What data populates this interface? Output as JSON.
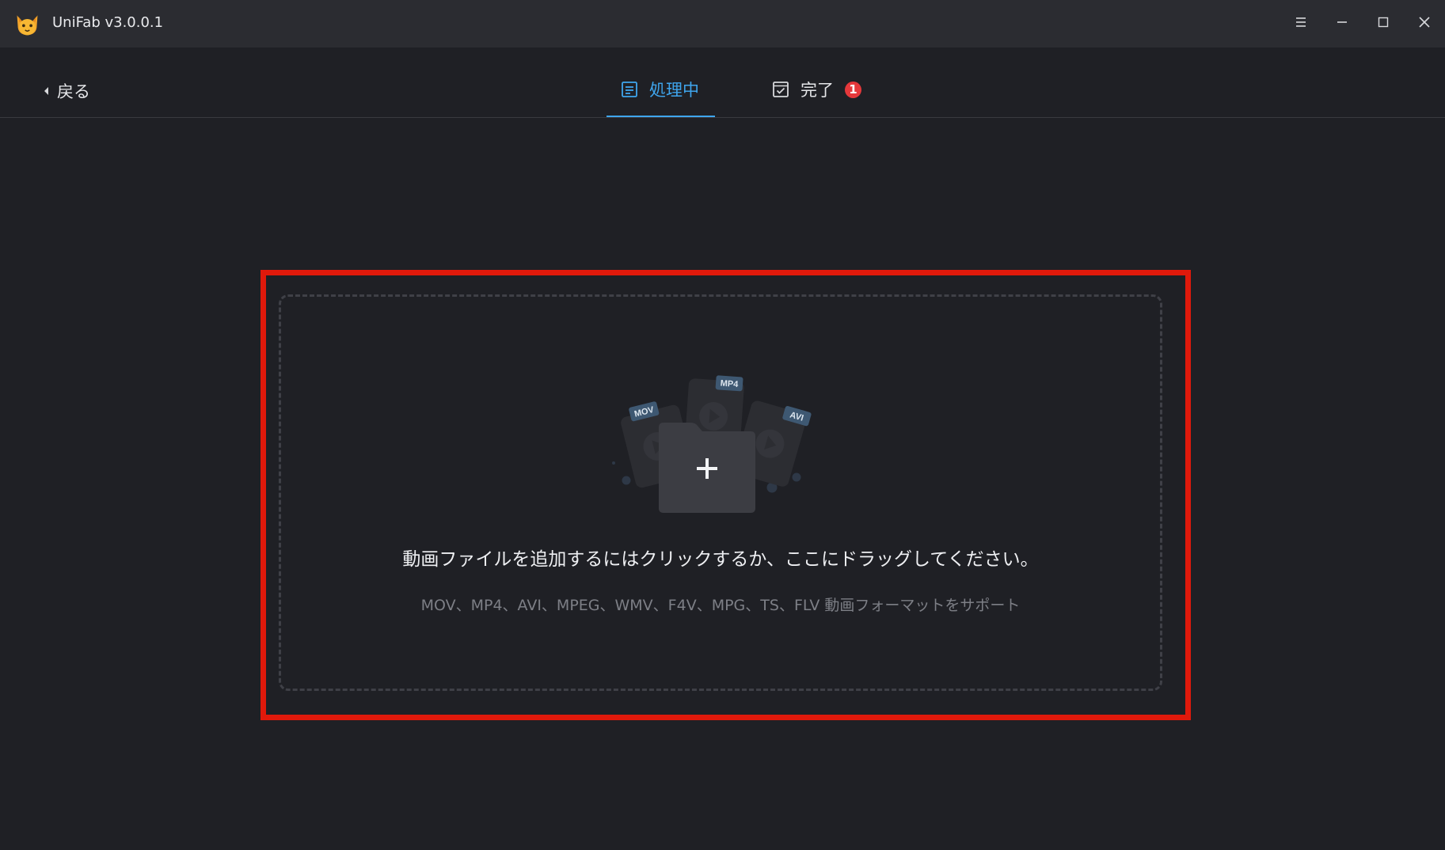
{
  "window": {
    "title": "UniFab v3.0.0.1"
  },
  "nav": {
    "back_label": "戻る",
    "tabs": [
      {
        "label": "処理中",
        "active": true
      },
      {
        "label": "完了",
        "badge": "1"
      }
    ]
  },
  "dropzone": {
    "main_text": "動画ファイルを追加するにはクリックするか、ここにドラッグしてください。",
    "sub_text": "MOV、MP4、AVI、MPEG、WMV、F4V、MPG、TS、FLV 動画フォーマットをサポート",
    "format_tags": [
      "MOV",
      "MP4",
      "AVI"
    ]
  },
  "colors": {
    "accent": "#3fa6ee",
    "highlight": "#e0190b",
    "badge": "#e5383b",
    "background": "#1f2025",
    "titlebar": "#2b2c31"
  },
  "icons": {
    "logo": "cat-logo-icon",
    "menu": "menu-icon",
    "minimize": "minimize-icon",
    "maximize": "maximize-icon",
    "close": "close-icon",
    "back": "chevron-left-icon",
    "tab_processing": "list-document-icon",
    "tab_done": "checkbox-icon",
    "add": "add-folder-icon"
  }
}
